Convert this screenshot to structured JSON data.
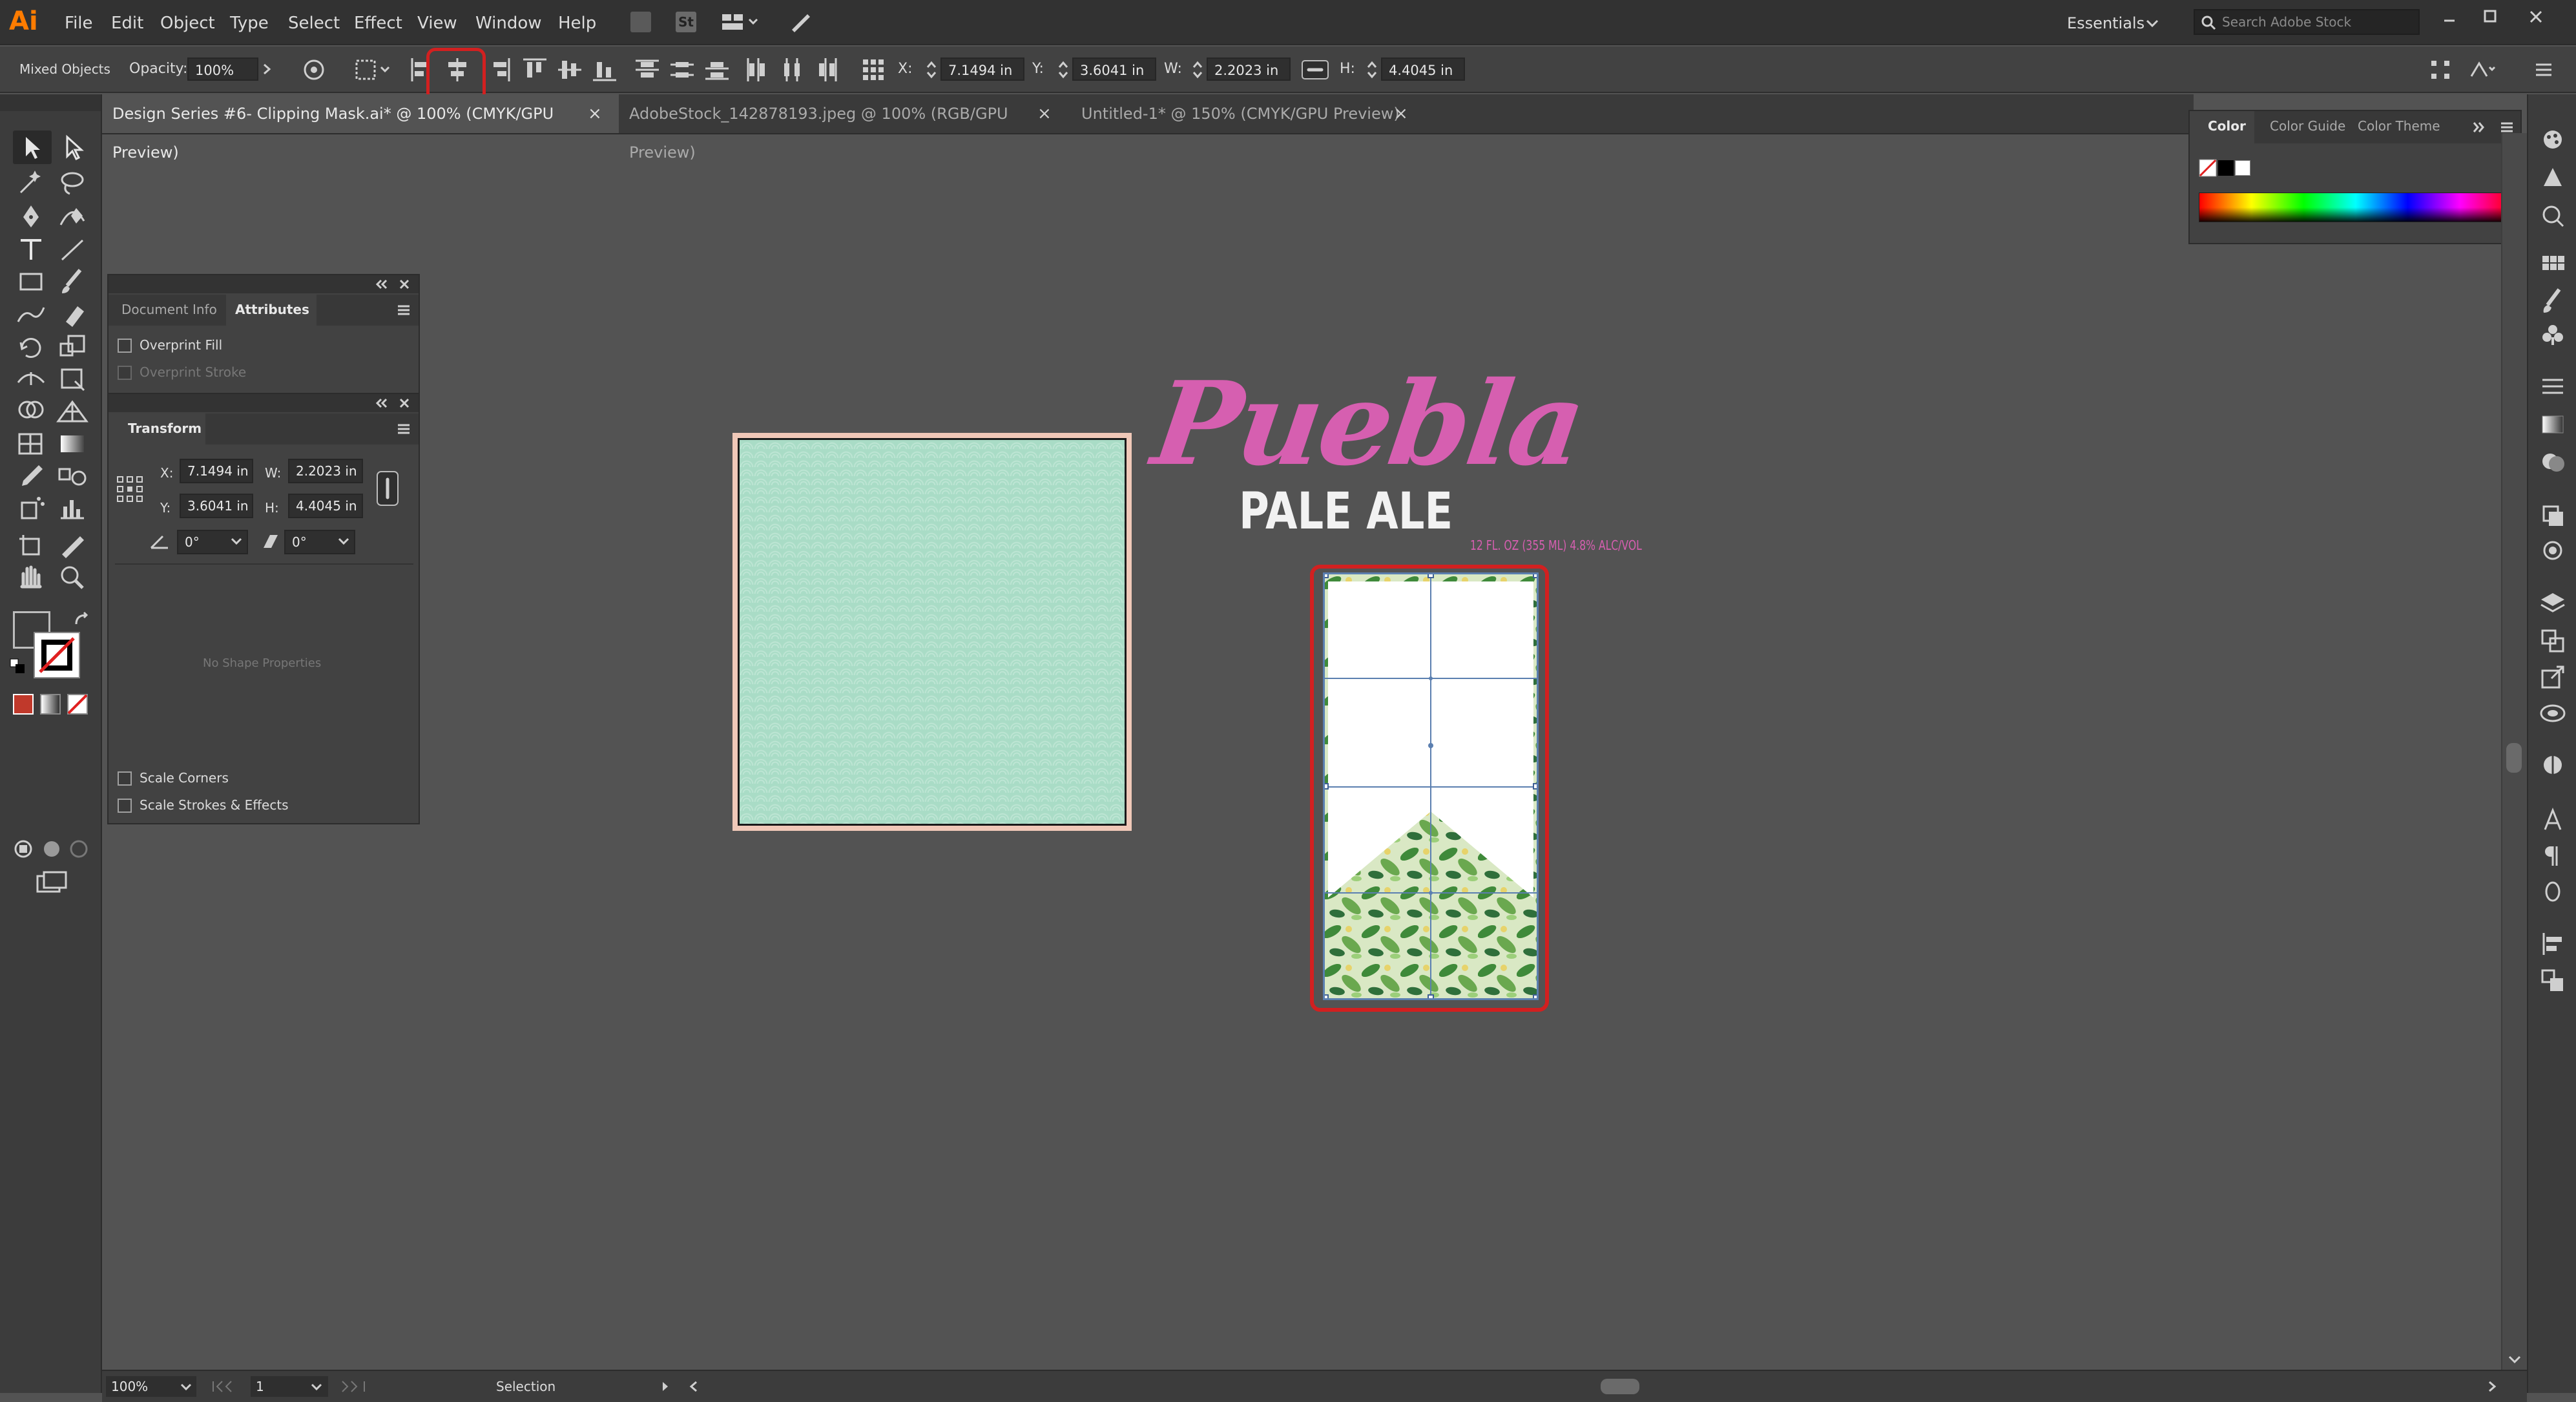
{
  "app": {
    "logo": "Ai"
  },
  "menu": [
    "File",
    "Edit",
    "Object",
    "Type",
    "Select",
    "Effect",
    "View",
    "Window",
    "Help"
  ],
  "workspace": {
    "label": "Essentials",
    "search_placeholder": "Search Adobe Stock"
  },
  "control": {
    "selection": "Mixed Objects",
    "opacity_label": "Opacity:",
    "opacity_value": "100%",
    "x_label": "X:",
    "x_value": "7.1494 in",
    "y_label": "Y:",
    "y_value": "3.6041 in",
    "w_label": "W:",
    "w_value": "2.2023 in",
    "h_label": "H:",
    "h_value": "4.4045 in"
  },
  "tabs": [
    {
      "label": "Design Series #6- Clipping Mask.ai* @ 100% (CMYK/GPU Preview)",
      "close": "×"
    },
    {
      "label": "AdobeStock_142878193.jpeg @ 100% (RGB/GPU Preview)",
      "close": "×"
    },
    {
      "label": "Untitled-1* @ 150% (CMYK/GPU Preview)",
      "close": "×"
    }
  ],
  "attributes_panel": {
    "tab_inactive": "Document Info",
    "tab_active": "Attributes",
    "overprint_fill": "Overprint Fill",
    "overprint_stroke": "Overprint Stroke"
  },
  "transform_panel": {
    "title": "Transform",
    "x_label": "X:",
    "x_value": "7.1494 in",
    "y_label": "Y:",
    "y_value": "3.6041 in",
    "w_label": "W:",
    "w_value": "2.2023 in",
    "h_label": "H:",
    "h_value": "4.4045 in",
    "rotate_value": "0°",
    "shear_value": "0°",
    "no_shape": "No Shape Properties",
    "scale_corners": "Scale Corners",
    "scale_strokes": "Scale Strokes & Effects"
  },
  "color_panel": {
    "tabs": [
      "Color",
      "Color Guide",
      "Color Theme"
    ]
  },
  "artwork": {
    "brand": "Puebla",
    "product": "PALE ALE",
    "volume": "12 FL. OZ (355 ML) 4.8% ALC/VOL"
  },
  "status": {
    "zoom": "100%",
    "page": "1",
    "tool": "Selection"
  },
  "colors": {
    "brand_pink": "#d65fb0",
    "highlight_red": "#d22020",
    "canvas": "#535353",
    "mint": "#a9dcc6"
  }
}
